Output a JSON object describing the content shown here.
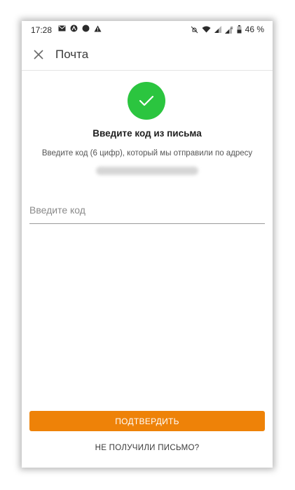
{
  "status_bar": {
    "time": "17:28",
    "battery": "46 %",
    "left_icons": [
      "mail-icon",
      "app-icon",
      "dot-icon",
      "alert-icon"
    ],
    "right_icons": [
      "mute-icon",
      "wifi-icon",
      "signal-icon",
      "signal-r-icon",
      "battery-icon"
    ]
  },
  "appbar": {
    "title": "Почта",
    "close_icon": "close-icon"
  },
  "content": {
    "success_icon": "check-icon",
    "success_color": "#2bc53f",
    "heading": "Введите код из письма",
    "subtext": "Введите код (6 цифр), который мы отправили по адресу"
  },
  "form": {
    "code_placeholder": "Введите код",
    "code_value": ""
  },
  "actions": {
    "confirm_label": "ПОДТВЕРДИТЬ",
    "confirm_color": "#ee8208",
    "resend_label": "НЕ ПОЛУЧИЛИ ПИСЬМО?"
  }
}
